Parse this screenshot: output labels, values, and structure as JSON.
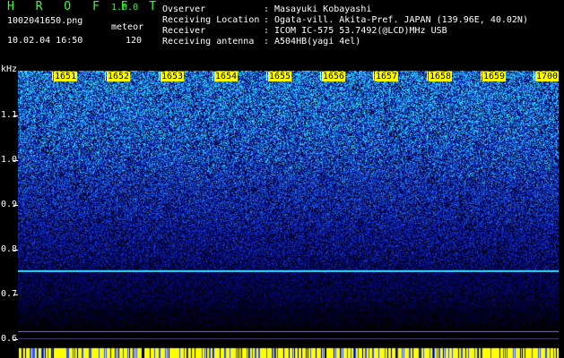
{
  "header": {
    "app_title": "H R O F F T",
    "app_version": "1.0.0",
    "filename": "1002041650.png",
    "mode": "meteor",
    "datetime": "10.02.04 16:50",
    "count": "120",
    "info": [
      {
        "label": "Ovserver",
        "value": "Masayuki Kobayashi"
      },
      {
        "label": "Receiving Location",
        "value": "Ogata-vill. Akita-Pref. JAPAN (139.96E, 40.02N)"
      },
      {
        "label": "Receiver",
        "value": "ICOM IC-575 53.7492(@LCD)MHz USB"
      },
      {
        "label": "Receiving antenna",
        "value": "A504HB(yagi 4el)"
      }
    ]
  },
  "plot": {
    "y_unit": "kHz",
    "y_ticks": [
      "1.1",
      "1.0",
      "0.9",
      "0.8",
      "0.7",
      "0.6"
    ],
    "x_ticks": [
      "1651",
      "1652",
      "1653",
      "1654",
      "1655",
      "1656",
      "1657",
      "1658",
      "1659",
      "1700"
    ],
    "carrier_line_khz": 0.755,
    "colors": {
      "background": "#000000",
      "noise_low": "#000050",
      "noise_mid": "#1f3fd0",
      "noise_high": "#22ccff",
      "carrier": "#33e0ff",
      "bottom_band": "#ffff00",
      "label_bg": "#ffff00"
    }
  }
}
